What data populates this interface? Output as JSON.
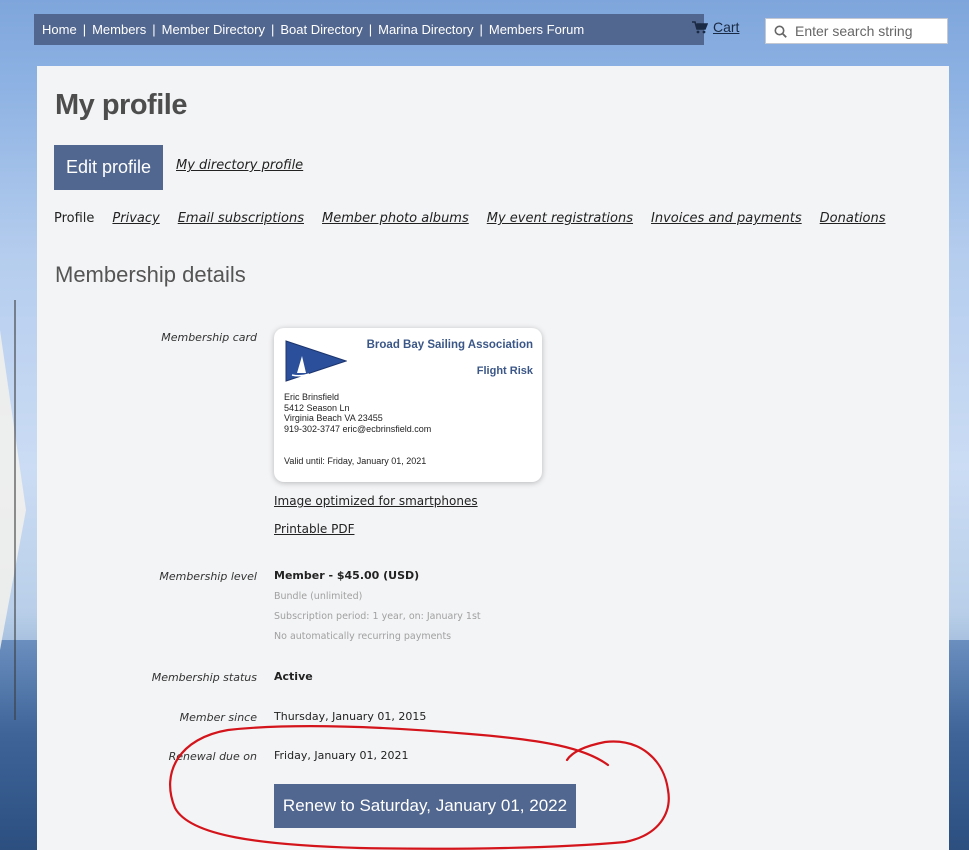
{
  "nav": {
    "items": [
      "Home",
      "Members",
      "Member Directory",
      "Boat Directory",
      "Marina Directory",
      "Members Forum"
    ],
    "cart_label": "Cart",
    "search_placeholder": "Enter search string"
  },
  "page": {
    "title": "My profile",
    "edit_button": "Edit profile",
    "directory_link": "My directory profile",
    "tabs": [
      "Profile",
      "Privacy",
      "Email subscriptions",
      "Member photo albums",
      "My event registrations",
      "Invoices and payments",
      "Donations"
    ],
    "section_title": "Membership details"
  },
  "membership": {
    "card_label": "Membership card",
    "card": {
      "org": "Broad Bay Sailing Association",
      "member_title": "Flight Risk",
      "name": "Eric Brinsfield",
      "street": "5412 Season Ln",
      "city": "Virginia Beach VA 23455",
      "contact": "919-302-3747  eric@ecbrinsfield.com",
      "valid": "Valid until: Friday, January 01, 2021"
    },
    "link_smartphone": "Image optimized for smartphones",
    "link_pdf": "Printable PDF",
    "level_label": "Membership level",
    "level_value": "Member - $45.00 (USD)",
    "level_sub1": "Bundle (unlimited)",
    "level_sub2": "Subscription period: 1 year, on: January 1st",
    "level_sub3": "No automatically recurring payments",
    "status_label": "Membership status",
    "status_value": "Active",
    "since_label": "Member since",
    "since_value": "Thursday, January 01, 2015",
    "renewal_label": "Renewal due on",
    "renewal_value": "Friday, January 01, 2021",
    "renew_button": "Renew to Saturday, January 01, 2022"
  },
  "colors": {
    "accent": "#52678f",
    "annotation": "#d4141b"
  }
}
